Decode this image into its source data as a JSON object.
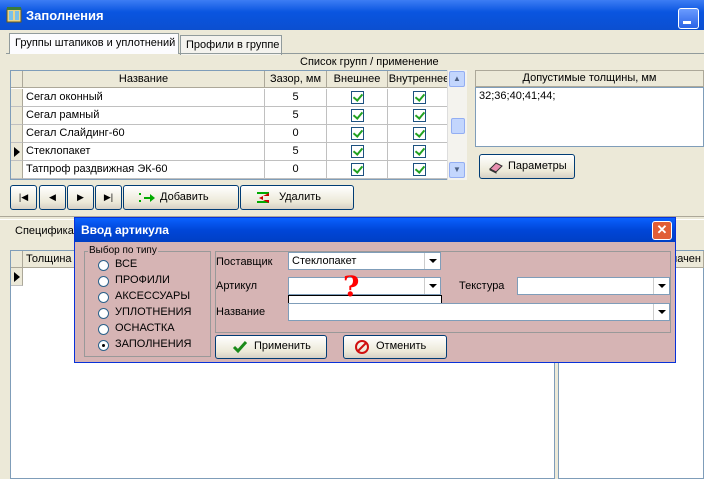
{
  "window": {
    "title": "Заполнения"
  },
  "tabs": [
    "Группы штапиков и уплотнений",
    "Профили в группе"
  ],
  "groups_caption": "Список групп  /  применение",
  "table": {
    "columns": [
      "Название",
      "Зазор, мм",
      "Внешнее",
      "Внутреннее"
    ],
    "rows": [
      {
        "name": "Сегал оконный",
        "gap": "5",
        "outer": true,
        "inner": true
      },
      {
        "name": "Сегал рамный",
        "gap": "5",
        "outer": true,
        "inner": true
      },
      {
        "name": "Сегал Слайдинг-60",
        "gap": "0",
        "outer": true,
        "inner": true
      },
      {
        "name": "Стеклопакет",
        "gap": "5",
        "outer": true,
        "inner": true
      },
      {
        "name": "Татпроф раздвижная ЭК-60",
        "gap": "0",
        "outer": true,
        "inner": true
      }
    ]
  },
  "thickness": {
    "caption": "Допустимые толщины, мм",
    "value": "32;36;40;41;44;"
  },
  "buttons": {
    "params": "Параметры",
    "add": "Добавить",
    "delete": "Удалить"
  },
  "lower": {
    "spec_label": "Спецификация",
    "col_thickness": "Толщина",
    "col_right": "значен"
  },
  "dialog": {
    "title": "Ввод артикула",
    "type_group_label": "Выбор по типу",
    "types": [
      {
        "label": "ВСЕ",
        "selected": false
      },
      {
        "label": "ПРОФИЛИ",
        "selected": false
      },
      {
        "label": "АКСЕССУАРЫ",
        "selected": false
      },
      {
        "label": "УПЛОТНЕНИЯ",
        "selected": false
      },
      {
        "label": "ОСНАСТКА",
        "selected": false
      },
      {
        "label": "ЗАПОЛНЕНИЯ",
        "selected": true
      }
    ],
    "supplier_label": "Поставщик",
    "supplier_value": "Стеклопакет",
    "article_label": "Артикул",
    "article_value": "",
    "texture_label": "Текстура",
    "texture_value": "",
    "name_label": "Название",
    "name_value": "",
    "apply": "Применить",
    "cancel": "Отменить",
    "annotation": "?",
    "annotation_color": "#ff0000"
  },
  "colors": {
    "titlebar": "#0a55e0",
    "dialog_bg": "#d6b4b4"
  }
}
